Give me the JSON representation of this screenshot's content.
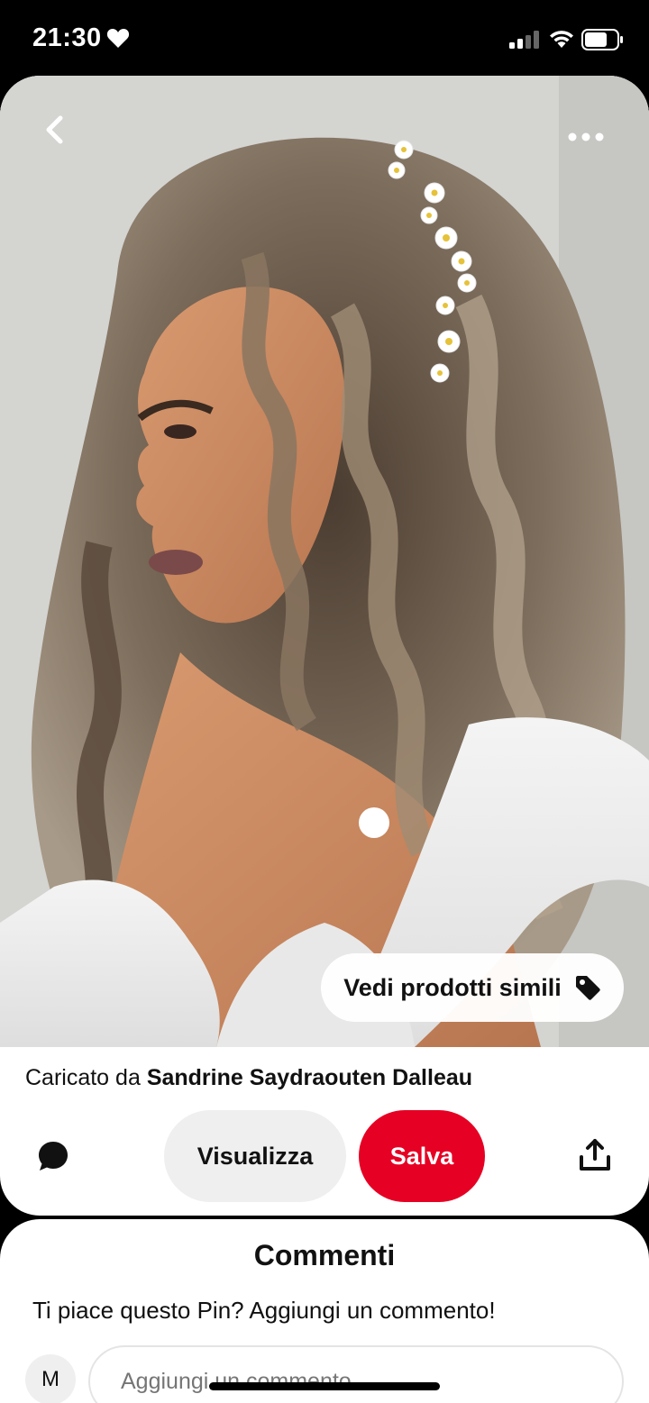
{
  "status_bar": {
    "time": "21:30",
    "icons": [
      "heart-icon",
      "signal-icon",
      "wifi-icon",
      "battery-icon"
    ]
  },
  "pin": {
    "image_alt": "",
    "top_bar_icons": [
      "back-chevron-icon",
      "more-dots-icon"
    ],
    "similar_products_label": "Vedi prodotti simili",
    "uploaded_by_prefix": "Caricato da",
    "uploader_name": "Sandrine Saydraouten Dalleau"
  },
  "actions": {
    "comment_icon": "comment-bubble-icon",
    "view_label": "Visualizza",
    "save_label": "Salva",
    "share_icon": "share-icon"
  },
  "comments": {
    "title": "Commenti",
    "prompt": "Ti piace questo Pin? Aggiungi un commento!",
    "avatar_initial": "M",
    "input_placeholder": "Aggiungi un commento"
  },
  "colors": {
    "brand_red": "#e60023",
    "light_gray_button": "#efefef"
  }
}
